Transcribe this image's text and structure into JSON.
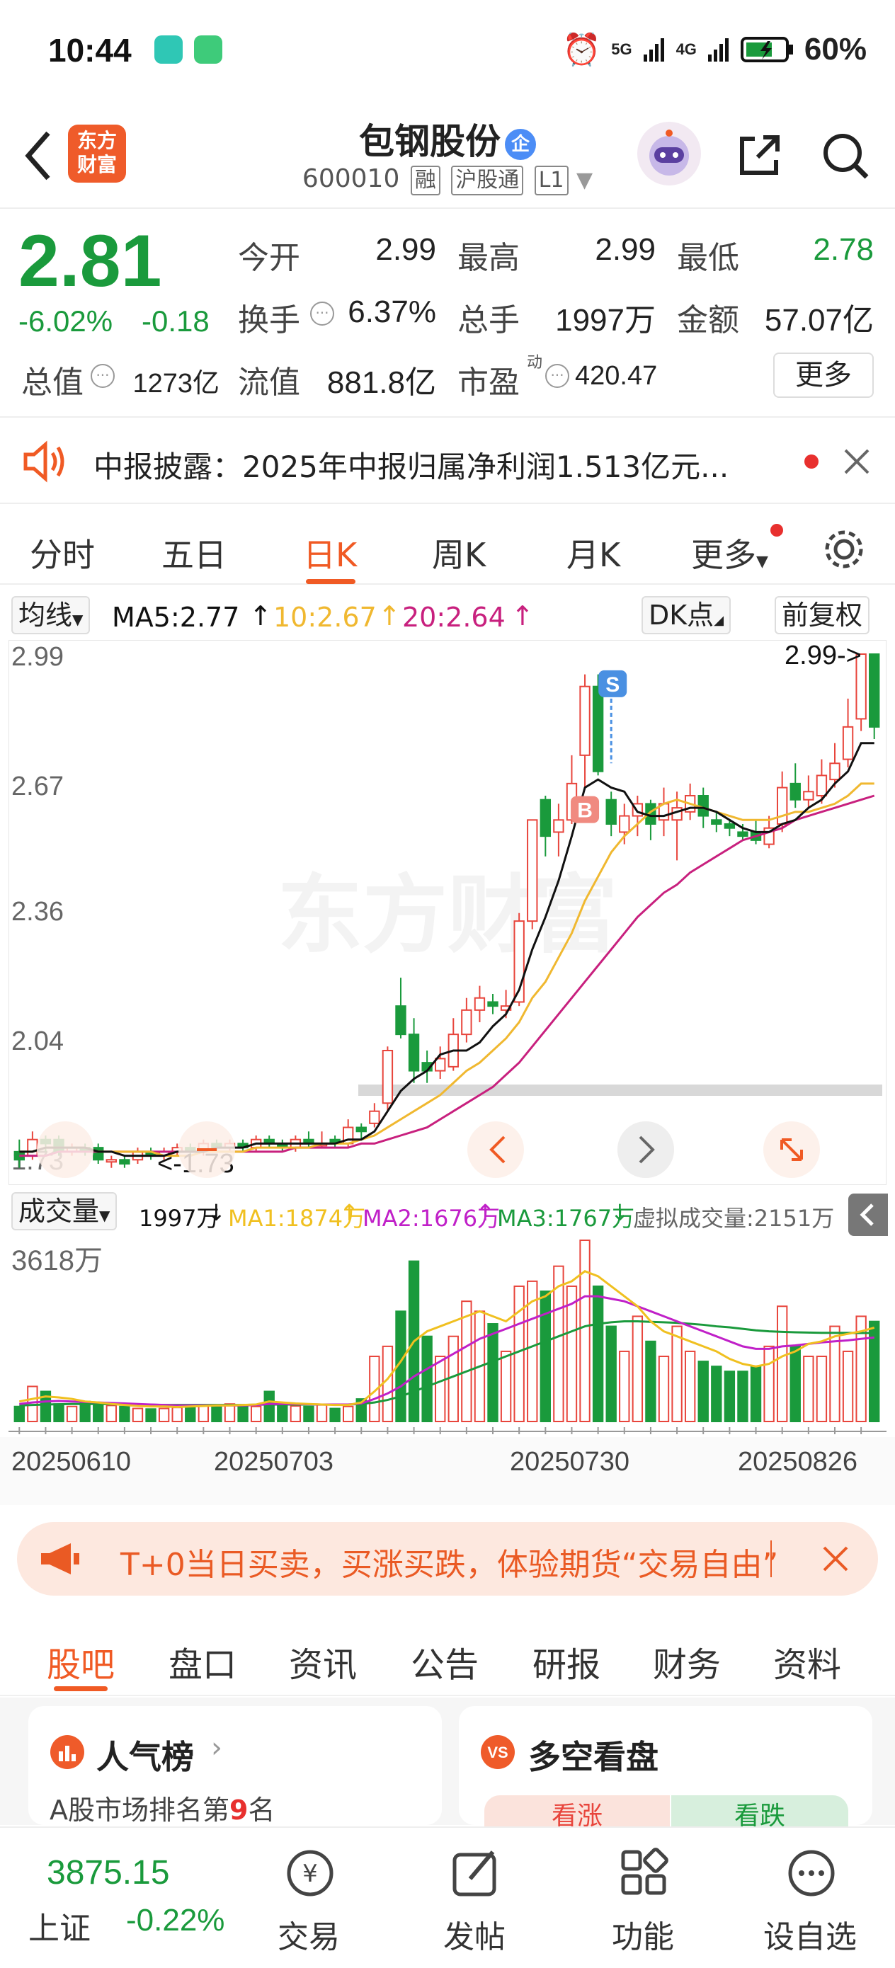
{
  "status_bar": {
    "time": "10:44",
    "network1": "5G",
    "network2": "4G",
    "battery": "60%"
  },
  "header": {
    "title": "包钢股份",
    "badge": "企",
    "code": "600010",
    "tags": [
      "融",
      "沪股通",
      "L1"
    ],
    "logo_line1": "东方",
    "logo_line2": "财富"
  },
  "quote": {
    "price": "2.81",
    "change_pct": "-6.02%",
    "change": "-0.18",
    "labels": [
      "今开",
      "最高",
      "最低",
      "换手",
      "总手",
      "金额",
      "总值",
      "流值",
      "市盈"
    ],
    "open": "2.99",
    "high": "2.99",
    "low": "2.78",
    "turnover": "6.37%",
    "volume": "1997万",
    "amount": "57.07亿",
    "market_cap": "1273亿",
    "float_cap": "881.8亿",
    "pe": "420.47",
    "pe_sup": "动",
    "more": "更多"
  },
  "notice": {
    "text": "中报披露：2025年中报归属净利润1.513亿元..."
  },
  "tabs": [
    "分时",
    "五日",
    "日K",
    "周K",
    "月K",
    "更多"
  ],
  "ma_bar": {
    "select": "均线",
    "ma5": "MA5:2.77",
    "ma10": "10:2.67",
    "ma20": "20:2.64",
    "dk": "DK点",
    "adj": "前复权"
  },
  "chart_data": {
    "type": "candlestick",
    "y_ticks": [
      "2.99",
      "2.67",
      "2.36",
      "2.04",
      "1.73"
    ],
    "ylim": [
      1.73,
      2.99
    ],
    "annotations": {
      "high_label": "2.99->",
      "low_label": "<-1.73",
      "buy": "B",
      "sell": "S"
    },
    "candles": [
      {
        "o": 1.76,
        "c": 1.74,
        "h": 1.79,
        "l": 1.72
      },
      {
        "o": 1.75,
        "c": 1.79,
        "h": 1.81,
        "l": 1.74
      },
      {
        "o": 1.79,
        "c": 1.78,
        "h": 1.8,
        "l": 1.76
      },
      {
        "o": 1.79,
        "c": 1.76,
        "h": 1.8,
        "l": 1.75
      },
      {
        "o": 1.76,
        "c": 1.77,
        "h": 1.78,
        "l": 1.75
      },
      {
        "o": 1.77,
        "c": 1.76,
        "h": 1.78,
        "l": 1.75
      },
      {
        "o": 1.77,
        "c": 1.74,
        "h": 1.78,
        "l": 1.73
      },
      {
        "o": 1.74,
        "c": 1.74,
        "h": 1.75,
        "l": 1.72
      },
      {
        "o": 1.74,
        "c": 1.73,
        "h": 1.75,
        "l": 1.72
      },
      {
        "o": 1.74,
        "c": 1.76,
        "h": 1.77,
        "l": 1.73
      },
      {
        "o": 1.76,
        "c": 1.75,
        "h": 1.77,
        "l": 1.74
      },
      {
        "o": 1.75,
        "c": 1.76,
        "h": 1.77,
        "l": 1.74
      },
      {
        "o": 1.76,
        "c": 1.77,
        "h": 1.78,
        "l": 1.75
      },
      {
        "o": 1.77,
        "c": 1.76,
        "h": 1.78,
        "l": 1.75
      },
      {
        "o": 1.76,
        "c": 1.78,
        "h": 1.79,
        "l": 1.75
      },
      {
        "o": 1.78,
        "c": 1.77,
        "h": 1.79,
        "l": 1.76
      },
      {
        "o": 1.77,
        "c": 1.78,
        "h": 1.79,
        "l": 1.76
      },
      {
        "o": 1.78,
        "c": 1.77,
        "h": 1.79,
        "l": 1.76
      },
      {
        "o": 1.77,
        "c": 1.79,
        "h": 1.8,
        "l": 1.76
      },
      {
        "o": 1.79,
        "c": 1.78,
        "h": 1.8,
        "l": 1.77
      },
      {
        "o": 1.78,
        "c": 1.77,
        "h": 1.79,
        "l": 1.76
      },
      {
        "o": 1.77,
        "c": 1.79,
        "h": 1.8,
        "l": 1.76
      },
      {
        "o": 1.79,
        "c": 1.78,
        "h": 1.81,
        "l": 1.77
      },
      {
        "o": 1.78,
        "c": 1.78,
        "h": 1.81,
        "l": 1.77
      },
      {
        "o": 1.79,
        "c": 1.78,
        "h": 1.8,
        "l": 1.77
      },
      {
        "o": 1.78,
        "c": 1.82,
        "h": 1.84,
        "l": 1.77
      },
      {
        "o": 1.82,
        "c": 1.81,
        "h": 1.83,
        "l": 1.79
      },
      {
        "o": 1.83,
        "c": 1.86,
        "h": 1.88,
        "l": 1.82
      },
      {
        "o": 1.88,
        "c": 2.01,
        "h": 2.02,
        "l": 1.86
      },
      {
        "o": 2.12,
        "c": 2.05,
        "h": 2.19,
        "l": 2.04
      },
      {
        "o": 2.05,
        "c": 1.96,
        "h": 2.09,
        "l": 1.93
      },
      {
        "o": 1.98,
        "c": 1.96,
        "h": 2.01,
        "l": 1.93
      },
      {
        "o": 1.96,
        "c": 1.99,
        "h": 2.02,
        "l": 1.94
      },
      {
        "o": 1.97,
        "c": 2.05,
        "h": 2.09,
        "l": 1.96
      },
      {
        "o": 2.05,
        "c": 2.11,
        "h": 2.14,
        "l": 2.03
      },
      {
        "o": 2.11,
        "c": 2.14,
        "h": 2.17,
        "l": 2.08
      },
      {
        "o": 2.13,
        "c": 2.12,
        "h": 2.15,
        "l": 2.1
      },
      {
        "o": 2.11,
        "c": 2.12,
        "h": 2.16,
        "l": 2.09
      },
      {
        "o": 2.13,
        "c": 2.33,
        "h": 2.35,
        "l": 2.12
      },
      {
        "o": 2.33,
        "c": 2.58,
        "h": 2.58,
        "l": 2.31
      },
      {
        "o": 2.63,
        "c": 2.54,
        "h": 2.64,
        "l": 2.49
      },
      {
        "o": 2.55,
        "c": 2.58,
        "h": 2.62,
        "l": 2.49
      },
      {
        "o": 2.58,
        "c": 2.67,
        "h": 2.74,
        "l": 2.57
      },
      {
        "o": 2.74,
        "c": 2.91,
        "h": 2.94,
        "l": 2.66
      },
      {
        "o": 2.91,
        "c": 2.7,
        "h": 2.94,
        "l": 2.69
      },
      {
        "o": 2.63,
        "c": 2.57,
        "h": 2.65,
        "l": 2.54
      },
      {
        "o": 2.55,
        "c": 2.59,
        "h": 2.62,
        "l": 2.52
      },
      {
        "o": 2.59,
        "c": 2.62,
        "h": 2.64,
        "l": 2.54
      },
      {
        "o": 2.62,
        "c": 2.57,
        "h": 2.63,
        "l": 2.53
      },
      {
        "o": 2.58,
        "c": 2.62,
        "h": 2.66,
        "l": 2.54
      },
      {
        "o": 2.58,
        "c": 2.61,
        "h": 2.65,
        "l": 2.48
      },
      {
        "o": 2.6,
        "c": 2.64,
        "h": 2.67,
        "l": 2.58
      },
      {
        "o": 2.64,
        "c": 2.59,
        "h": 2.66,
        "l": 2.56
      },
      {
        "o": 2.58,
        "c": 2.57,
        "h": 2.6,
        "l": 2.55
      },
      {
        "o": 2.57,
        "c": 2.56,
        "h": 2.58,
        "l": 2.54
      },
      {
        "o": 2.55,
        "c": 2.54,
        "h": 2.57,
        "l": 2.53
      },
      {
        "o": 2.55,
        "c": 2.53,
        "h": 2.58,
        "l": 2.52
      },
      {
        "o": 2.52,
        "c": 2.56,
        "h": 2.59,
        "l": 2.51
      },
      {
        "o": 2.57,
        "c": 2.66,
        "h": 2.7,
        "l": 2.55
      },
      {
        "o": 2.67,
        "c": 2.63,
        "h": 2.72,
        "l": 2.61
      },
      {
        "o": 2.63,
        "c": 2.65,
        "h": 2.69,
        "l": 2.61
      },
      {
        "o": 2.64,
        "c": 2.69,
        "h": 2.73,
        "l": 2.62
      },
      {
        "o": 2.68,
        "c": 2.72,
        "h": 2.77,
        "l": 2.66
      },
      {
        "o": 2.73,
        "c": 2.81,
        "h": 2.88,
        "l": 2.71
      },
      {
        "o": 2.83,
        "c": 2.99,
        "h": 2.99,
        "l": 2.8
      },
      {
        "o": 2.99,
        "c": 2.81,
        "h": 2.99,
        "l": 2.78
      }
    ],
    "ma5": [
      1.76,
      1.76,
      1.77,
      1.77,
      1.77,
      1.77,
      1.76,
      1.76,
      1.75,
      1.75,
      1.75,
      1.75,
      1.76,
      1.76,
      1.76,
      1.77,
      1.77,
      1.77,
      1.78,
      1.78,
      1.78,
      1.78,
      1.78,
      1.78,
      1.78,
      1.79,
      1.79,
      1.81,
      1.86,
      1.91,
      1.94,
      1.96,
      2.0,
      2.01,
      2.01,
      2.03,
      2.07,
      2.1,
      2.16,
      2.26,
      2.34,
      2.43,
      2.54,
      2.66,
      2.68,
      2.66,
      2.65,
      2.6,
      2.59,
      2.59,
      2.6,
      2.61,
      2.61,
      2.6,
      2.58,
      2.56,
      2.55,
      2.55,
      2.57,
      2.58,
      2.61,
      2.63,
      2.67,
      2.7,
      2.77,
      2.77
    ],
    "ma10": [
      1.76,
      1.76,
      1.77,
      1.77,
      1.77,
      1.77,
      1.76,
      1.76,
      1.76,
      1.76,
      1.76,
      1.75,
      1.75,
      1.75,
      1.76,
      1.76,
      1.76,
      1.76,
      1.77,
      1.77,
      1.77,
      1.77,
      1.77,
      1.78,
      1.78,
      1.78,
      1.79,
      1.8,
      1.82,
      1.84,
      1.86,
      1.88,
      1.9,
      1.93,
      1.96,
      1.98,
      2.01,
      2.04,
      2.08,
      2.14,
      2.18,
      2.24,
      2.3,
      2.38,
      2.44,
      2.5,
      2.54,
      2.57,
      2.6,
      2.62,
      2.63,
      2.62,
      2.61,
      2.6,
      2.59,
      2.58,
      2.58,
      2.58,
      2.59,
      2.6,
      2.6,
      2.61,
      2.62,
      2.64,
      2.67,
      2.67
    ],
    "ma20": [
      1.75,
      1.75,
      1.75,
      1.76,
      1.76,
      1.76,
      1.76,
      1.76,
      1.76,
      1.76,
      1.76,
      1.76,
      1.76,
      1.76,
      1.76,
      1.76,
      1.76,
      1.76,
      1.76,
      1.76,
      1.76,
      1.77,
      1.77,
      1.77,
      1.77,
      1.77,
      1.78,
      1.78,
      1.79,
      1.8,
      1.81,
      1.82,
      1.84,
      1.86,
      1.88,
      1.9,
      1.92,
      1.95,
      1.98,
      2.02,
      2.06,
      2.1,
      2.14,
      2.18,
      2.22,
      2.26,
      2.3,
      2.34,
      2.37,
      2.4,
      2.42,
      2.45,
      2.47,
      2.49,
      2.51,
      2.53,
      2.54,
      2.55,
      2.56,
      2.58,
      2.59,
      2.6,
      2.61,
      2.62,
      2.63,
      2.64
    ]
  },
  "volume_bar": {
    "select": "成交量",
    "vol": "1997万",
    "ma1": "MA1:1874万",
    "ma2": "MA2:1676万",
    "ma3": "MA3:1767万",
    "virtual": "虚拟成交量:2151万",
    "max_label": "3618万"
  },
  "volume_data": {
    "max": 3618,
    "values": [
      300,
      700,
      600,
      350,
      300,
      400,
      350,
      320,
      300,
      260,
      250,
      260,
      280,
      300,
      320,
      330,
      350,
      330,
      300,
      600,
      330,
      310,
      300,
      330,
      260,
      300,
      450,
      1300,
      1500,
      2200,
      3200,
      1700,
      1300,
      1700,
      2400,
      2200,
      1950,
      1400,
      2700,
      2800,
      2600,
      3100,
      2700,
      3618,
      2700,
      1900,
      1400,
      2100,
      1600,
      1300,
      1900,
      1400,
      1200,
      1100,
      1000,
      1000,
      1100,
      1500,
      2300,
      1500,
      1300,
      1300,
      1900,
      1400,
      2100,
      1997
    ],
    "ma1": [
      400,
      450,
      500,
      480,
      450,
      400,
      380,
      350,
      330,
      310,
      300,
      300,
      290,
      300,
      310,
      320,
      320,
      330,
      340,
      400,
      380,
      360,
      350,
      340,
      330,
      330,
      380,
      600,
      850,
      1200,
      1600,
      1800,
      1900,
      2000,
      2100,
      2200,
      2100,
      2000,
      2200,
      2400,
      2500,
      2700,
      2800,
      3000,
      2900,
      2700,
      2500,
      2300,
      2000,
      1800,
      1700,
      1600,
      1500,
      1400,
      1250,
      1150,
      1100,
      1150,
      1300,
      1400,
      1550,
      1600,
      1700,
      1750,
      1800,
      1874
    ],
    "ma2": [
      350,
      380,
      400,
      410,
      400,
      390,
      380,
      370,
      360,
      350,
      340,
      330,
      320,
      320,
      320,
      320,
      320,
      320,
      330,
      350,
      350,
      350,
      345,
      340,
      340,
      340,
      360,
      450,
      560,
      700,
      900,
      1050,
      1200,
      1350,
      1500,
      1650,
      1750,
      1850,
      1950,
      2050,
      2150,
      2250,
      2350,
      2500,
      2500,
      2450,
      2400,
      2300,
      2200,
      2100,
      2000,
      1900,
      1800,
      1700,
      1600,
      1500,
      1450,
      1450,
      1500,
      1520,
      1550,
      1580,
      1600,
      1620,
      1650,
      1676
    ],
    "ma3": [
      320,
      330,
      340,
      345,
      350,
      350,
      350,
      345,
      340,
      340,
      335,
      330,
      330,
      330,
      330,
      330,
      330,
      330,
      335,
      340,
      340,
      340,
      340,
      340,
      340,
      340,
      350,
      380,
      430,
      500,
      600,
      700,
      800,
      900,
      1000,
      1100,
      1200,
      1300,
      1400,
      1500,
      1600,
      1700,
      1800,
      1900,
      1950,
      1980,
      2000,
      2000,
      1990,
      1980,
      1970,
      1950,
      1930,
      1900,
      1880,
      1850,
      1820,
      1800,
      1790,
      1780,
      1775,
      1770,
      1770,
      1768,
      1767,
      1767
    ]
  },
  "x_dates": [
    "20250610",
    "20250703",
    "20250730",
    "20250826"
  ],
  "promo": {
    "text": "T+0当日买卖，买涨买跌，体验期货“交易自由”"
  },
  "subtabs": [
    "股吧",
    "盘口",
    "资讯",
    "公告",
    "研报",
    "财务",
    "资料"
  ],
  "cards": {
    "left_title": "人气榜",
    "left_sub": "A股市场排名第",
    "left_rank": "9",
    "left_sub2": "名",
    "right_title": "多空看盘",
    "bull": "看涨",
    "bear": "看跌"
  },
  "bottom_nav": {
    "index_value": "3875.15",
    "index_name": "上证",
    "index_change": "-0.22%",
    "items": [
      "交易",
      "发帖",
      "功能",
      "设自选"
    ]
  },
  "colors": {
    "up": "#e8453c",
    "down": "#1a9a3c",
    "accent": "#f05a24",
    "ma5": "#111111",
    "ma10": "#f0b830",
    "ma20": "#c8207e",
    "vma1": "#f0c020",
    "vma2": "#c020c8",
    "vma3": "#1a9a3c"
  }
}
